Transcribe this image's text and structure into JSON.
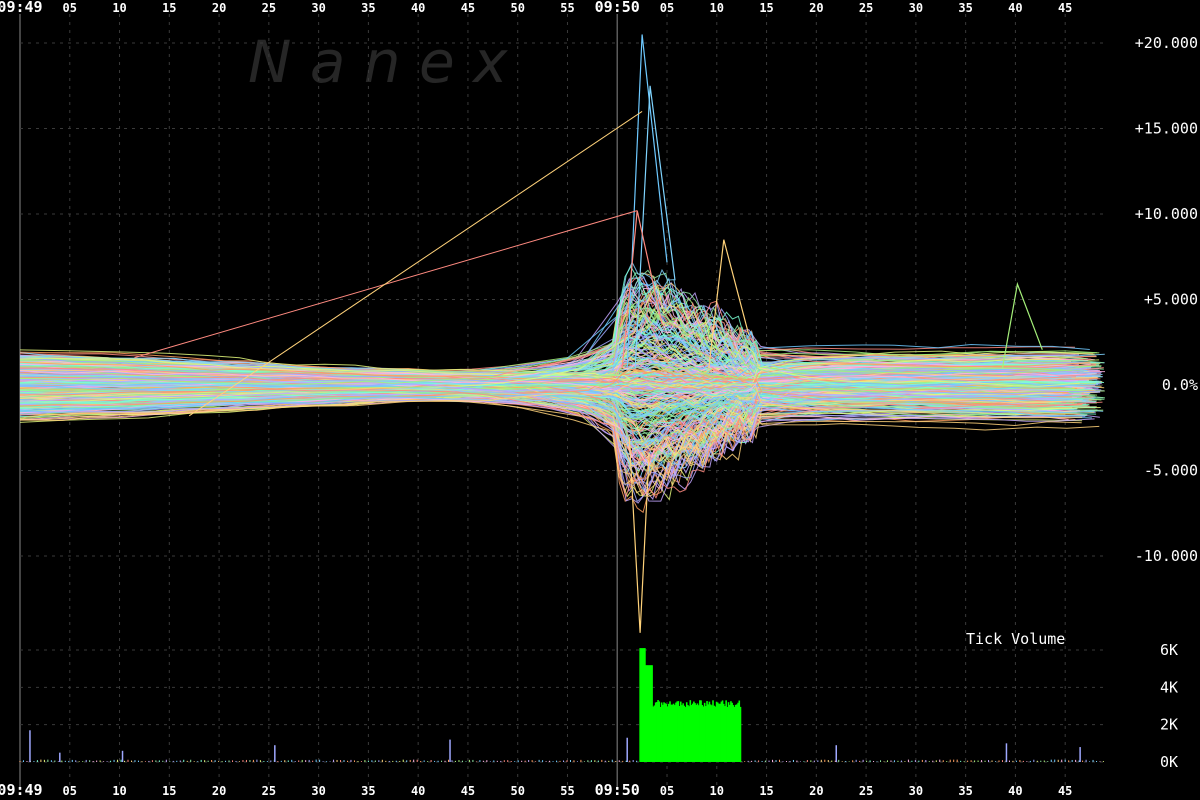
{
  "watermark": "N a n e x",
  "chart_data": [
    {
      "type": "line",
      "title": "",
      "xlabel": "",
      "ylabel": "",
      "x_ticks_top": [
        "09:49",
        "05",
        "10",
        "15",
        "20",
        "25",
        "30",
        "35",
        "40",
        "45",
        "50",
        "55",
        "09:50",
        "05",
        "10",
        "15",
        "20",
        "25",
        "30",
        "35",
        "40",
        "45"
      ],
      "x_ticks_bottom": [
        "09:49",
        "05",
        "10",
        "15",
        "20",
        "25",
        "30",
        "35",
        "40",
        "45",
        "50",
        "55",
        "09:50",
        "05",
        "10",
        "15",
        "20",
        "25",
        "30",
        "35",
        "40",
        "45"
      ],
      "x_tick_seconds": [
        0,
        5,
        10,
        15,
        20,
        25,
        30,
        35,
        40,
        45,
        50,
        55,
        60,
        65,
        70,
        75,
        80,
        85,
        90,
        95,
        100,
        105
      ],
      "x_range_seconds": [
        0,
        109
      ],
      "y_ticks": [
        "+20.000",
        "+15.000",
        "+10.000",
        "+5.000",
        "0.0%",
        "-5.000",
        "-10.000"
      ],
      "y_tick_values": [
        20,
        15,
        10,
        5,
        0,
        -5,
        -10
      ],
      "ylim": [
        -13.3,
        22.5
      ],
      "grid": true,
      "series_count_approx": 400,
      "event_second": 60,
      "peak_high_pct": 20.5,
      "peak_low_pct": -14.5,
      "notes_high_outliers": [
        {
          "x": 62.5,
          "y": 20.5
        },
        {
          "x": 63.3,
          "y": 17.5
        },
        {
          "x": 62.0,
          "y": 10.2
        },
        {
          "x": 70.7,
          "y": 8.5
        },
        {
          "x": 100.2,
          "y": 5.9
        }
      ]
    },
    {
      "type": "bar",
      "label": "Tick Volume",
      "y_ticks": [
        "6K",
        "4K",
        "2K",
        "0K"
      ],
      "y_tick_values": [
        6000,
        4000,
        2000,
        0
      ],
      "ylim": [
        0,
        6800
      ],
      "x_range_seconds": [
        0,
        109
      ],
      "burst": {
        "start_second": 62.3,
        "end_second": 72.5,
        "peak": 6100,
        "typical": 3200
      },
      "baseline_typical": 100,
      "baseline_spikes": [
        {
          "x": 1,
          "v": 1700
        },
        {
          "x": 4,
          "v": 500
        },
        {
          "x": 10.3,
          "v": 600
        },
        {
          "x": 25.6,
          "v": 900
        },
        {
          "x": 43.2,
          "v": 1200
        },
        {
          "x": 61,
          "v": 1300
        },
        {
          "x": 68.2,
          "v": 900
        },
        {
          "x": 70.1,
          "v": 700
        },
        {
          "x": 82,
          "v": 900
        },
        {
          "x": 99.1,
          "v": 1000
        },
        {
          "x": 106.5,
          "v": 800
        }
      ]
    }
  ]
}
